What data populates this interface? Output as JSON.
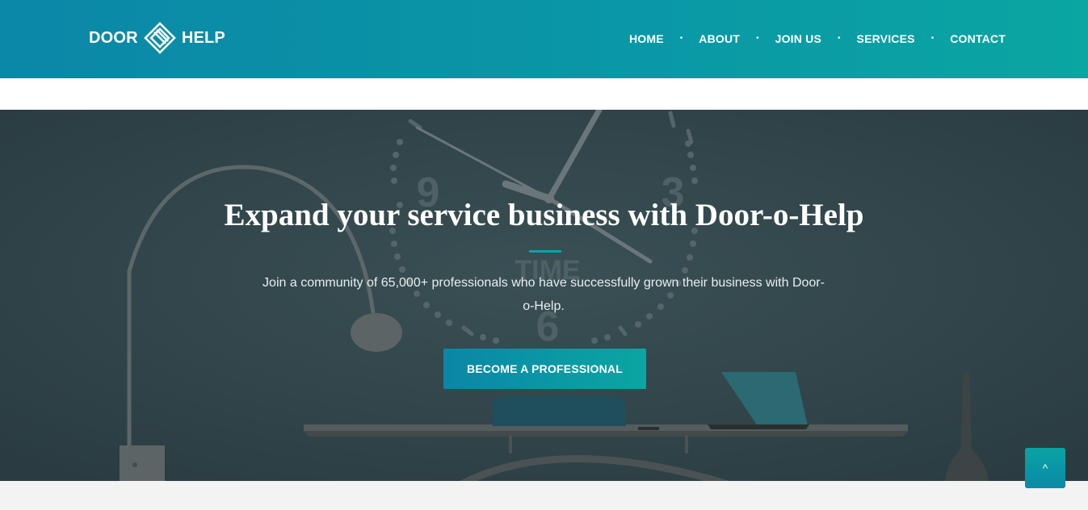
{
  "brand": {
    "word_left": "DOOR",
    "word_right": "HELP",
    "logo_icon": "diamond-knot-icon"
  },
  "nav": {
    "items": [
      {
        "label": "HOME"
      },
      {
        "label": "ABOUT"
      },
      {
        "label": "JOIN US"
      },
      {
        "label": "SERVICES"
      },
      {
        "label": "CONTACT"
      }
    ],
    "separator": "•"
  },
  "hero": {
    "title": "Expand your service business with Door-o-Help",
    "subtitle": "Join a community of 65,000+ professionals who have successfully grown their business with Door-o-Help.",
    "cta_label": "BECOME A PROFESSIONAL",
    "background_text": {
      "clock_word": "TIME",
      "nine": "9",
      "three": "3",
      "six": "6"
    }
  },
  "scroll_top": {
    "icon": "chevron-up-icon",
    "glyph": "^"
  },
  "colors": {
    "header_start": "#0b87a7",
    "header_end": "#0aa6a2",
    "accent": "#0aa3a8",
    "hero_overlay": "#2f4449"
  }
}
